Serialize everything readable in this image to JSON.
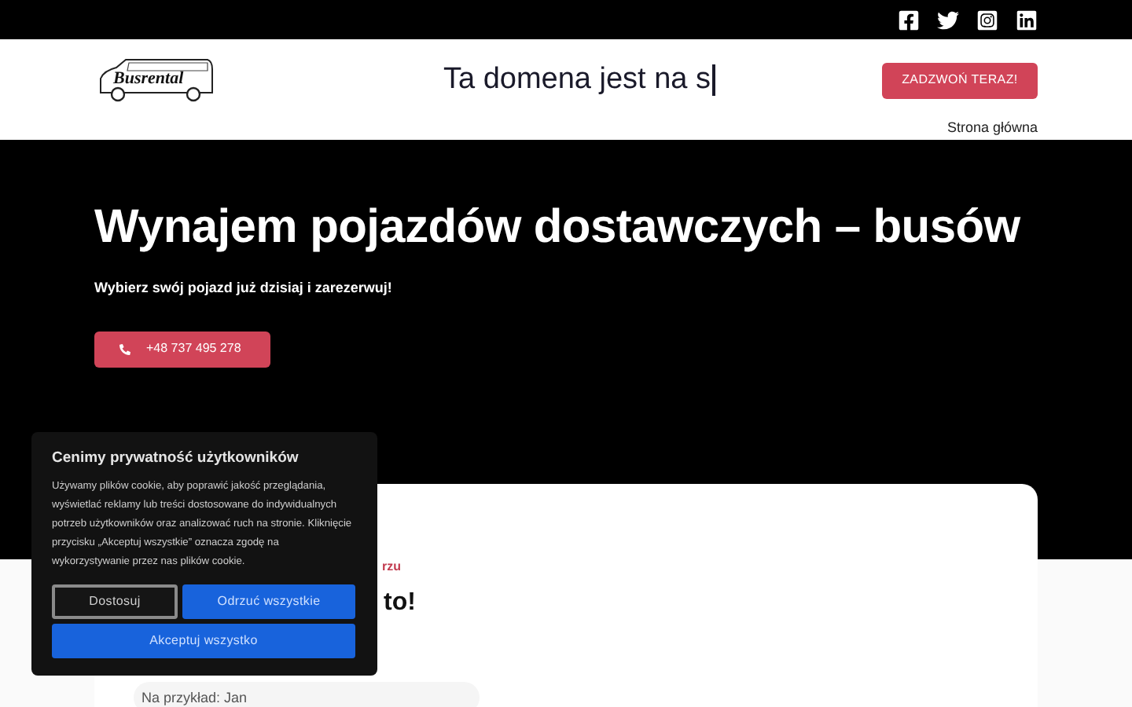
{
  "top_bar": {
    "social_links": [
      {
        "kind": "facebook"
      },
      {
        "kind": "twitter"
      },
      {
        "kind": "instagram"
      },
      {
        "kind": "linkedin"
      }
    ]
  },
  "header": {
    "logo": "Busrental",
    "headline": "Ta domena jest na s",
    "call_button": "ZADZWOŃ TERAZ!",
    "nav": [
      "Strona główna"
    ]
  },
  "hero": {
    "title": "Wynajem pojazdów dostawczych – busów",
    "subtitle": "Wybierz swój pojazd już dzisiaj i zarezerwuj!",
    "phone_button": "+48 737 495 278"
  },
  "form_card": {
    "eyebrow": "rzu",
    "heading": "to!",
    "name_field": {
      "placeholder": "Na przykład: Jan"
    }
  },
  "cookie_banner": {
    "title": "Cenimy prywatność użytkowników",
    "body": "Używamy plików cookie, aby poprawić jakość przeglądania, wyświetlać reklamy lub treści dostosowane do indywidualnych potrzeb użytkowników oraz analizować ruch na stronie. Kliknięcie przycisku „Akceptuj wszystkie” oznacza zgodę na wykorzystywanie przez nas plików cookie.",
    "buttons": [
      {
        "label": "Dostosuj",
        "kind": "outline"
      },
      {
        "label": "Odrzuć wszystkie",
        "kind": "primary"
      },
      {
        "label": "Akceptuj wszystko",
        "kind": "primary"
      }
    ]
  }
}
